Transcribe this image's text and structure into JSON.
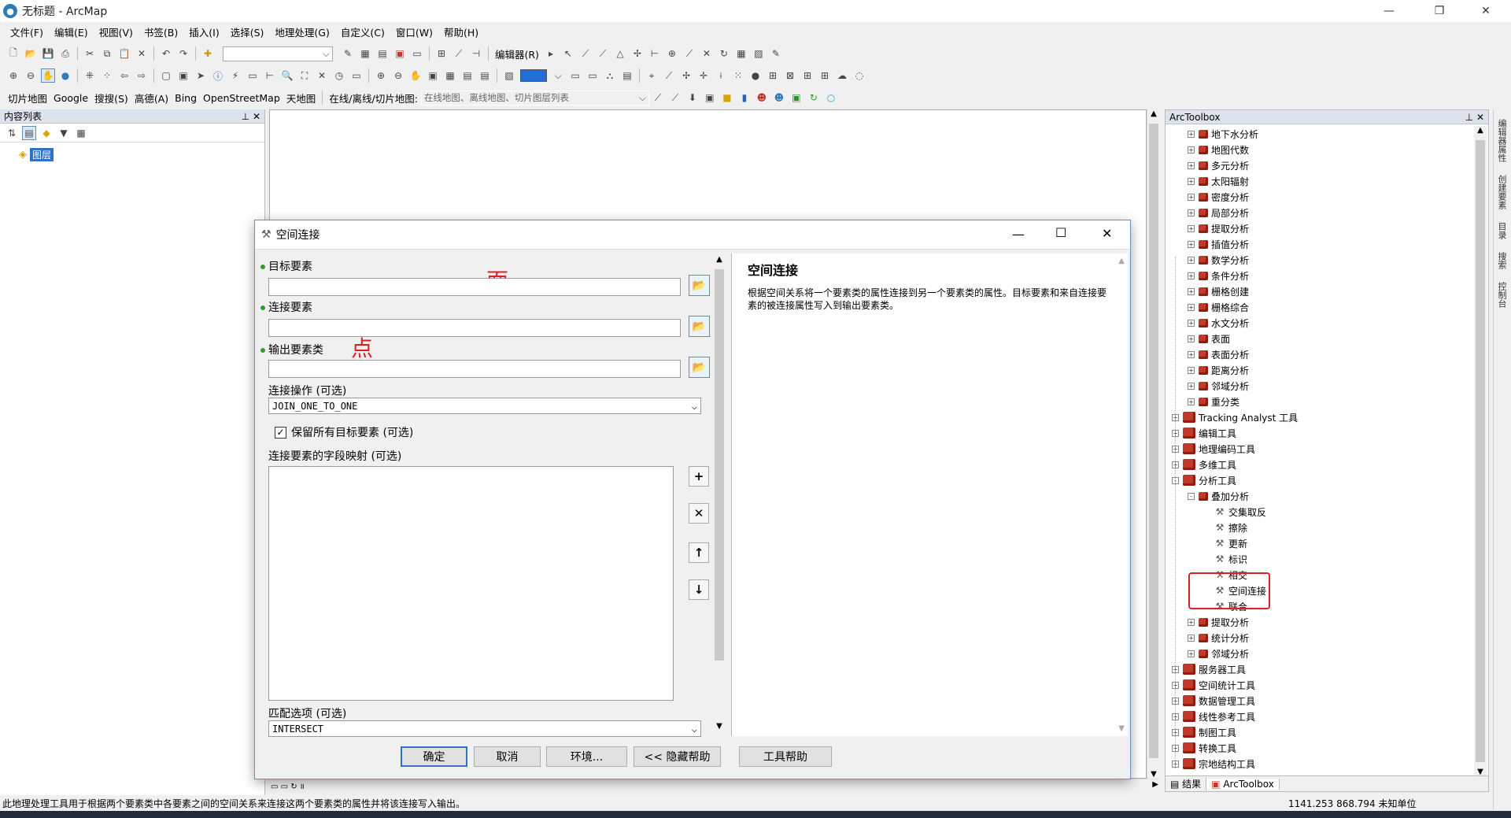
{
  "window": {
    "title": "无标题 - ArcMap"
  },
  "menu": [
    "文件(F)",
    "编辑(E)",
    "视图(V)",
    "书签(B)",
    "插入(I)",
    "选择(S)",
    "地理处理(G)",
    "自定义(C)",
    "窗口(W)",
    "帮助(H)"
  ],
  "toolbar": {
    "editor_label": "编辑器(R)",
    "tile_label": "切片地图",
    "google": "Google",
    "sougou": "搜搜(S)",
    "gaode": "高德(A)",
    "bing": "Bing",
    "osm": "OpenStreetMap",
    "tianditu": "天地图",
    "online_label": "在线/离线/切片地图:",
    "online_combo": "在线地图、离线地图、切片图层列表"
  },
  "toc": {
    "title": "内容列表",
    "layers_label": "图层"
  },
  "dialog": {
    "title": "空间连接",
    "target_label": "目标要素",
    "join_label": "连接要素",
    "output_label": "输出要素类",
    "annotation_face": "面",
    "annotation_point": "点",
    "join_op_label": "连接操作 (可选)",
    "join_op_value": "JOIN_ONE_TO_ONE",
    "keep_all_label": "保留所有目标要素 (可选)",
    "field_map_label": "连接要素的字段映射 (可选)",
    "match_label": "匹配选项 (可选)",
    "match_value": "INTERSECT",
    "help_title": "空间连接",
    "help_text": "根据空间关系将一个要素类的属性连接到另一个要素类的属性。目标要素和来自连接要素的被连接属性写入到输出要素类。",
    "buttons": {
      "ok": "确定",
      "cancel": "取消",
      "env": "环境...",
      "hide_help": "<< 隐藏帮助",
      "tool_help": "工具帮助"
    }
  },
  "arctoolbox": {
    "title": "ArcToolbox",
    "items": [
      {
        "label": "地下水分析",
        "level": 1,
        "type": "toolset",
        "exp": "+"
      },
      {
        "label": "地图代数",
        "level": 1,
        "type": "toolset",
        "exp": "+"
      },
      {
        "label": "多元分析",
        "level": 1,
        "type": "toolset",
        "exp": "+"
      },
      {
        "label": "太阳辐射",
        "level": 1,
        "type": "toolset",
        "exp": "+"
      },
      {
        "label": "密度分析",
        "level": 1,
        "type": "toolset",
        "exp": "+"
      },
      {
        "label": "局部分析",
        "level": 1,
        "type": "toolset",
        "exp": "+"
      },
      {
        "label": "提取分析",
        "level": 1,
        "type": "toolset",
        "exp": "+"
      },
      {
        "label": "插值分析",
        "level": 1,
        "type": "toolset",
        "exp": "+"
      },
      {
        "label": "数学分析",
        "level": 1,
        "type": "toolset",
        "exp": "+"
      },
      {
        "label": "条件分析",
        "level": 1,
        "type": "toolset",
        "exp": "+"
      },
      {
        "label": "栅格创建",
        "level": 1,
        "type": "toolset",
        "exp": "+"
      },
      {
        "label": "栅格综合",
        "level": 1,
        "type": "toolset",
        "exp": "+"
      },
      {
        "label": "水文分析",
        "level": 1,
        "type": "toolset",
        "exp": "+"
      },
      {
        "label": "表面",
        "level": 1,
        "type": "toolset",
        "exp": "+"
      },
      {
        "label": "表面分析",
        "level": 1,
        "type": "toolset",
        "exp": "+"
      },
      {
        "label": "距离分析",
        "level": 1,
        "type": "toolset",
        "exp": "+"
      },
      {
        "label": "邻域分析",
        "level": 1,
        "type": "toolset",
        "exp": "+"
      },
      {
        "label": "重分类",
        "level": 1,
        "type": "toolset",
        "exp": "+"
      },
      {
        "label": "Tracking Analyst 工具",
        "level": 0,
        "type": "toolbox",
        "exp": "+"
      },
      {
        "label": "编辑工具",
        "level": 0,
        "type": "toolbox",
        "exp": "+"
      },
      {
        "label": "地理编码工具",
        "level": 0,
        "type": "toolbox",
        "exp": "+"
      },
      {
        "label": "多维工具",
        "level": 0,
        "type": "toolbox",
        "exp": "+"
      },
      {
        "label": "分析工具",
        "level": 0,
        "type": "toolbox",
        "exp": "-"
      },
      {
        "label": "叠加分析",
        "level": 1,
        "type": "toolset",
        "exp": "-"
      },
      {
        "label": "交集取反",
        "level": 2,
        "type": "tool",
        "exp": ""
      },
      {
        "label": "擦除",
        "level": 2,
        "type": "tool",
        "exp": ""
      },
      {
        "label": "更新",
        "level": 2,
        "type": "tool",
        "exp": ""
      },
      {
        "label": "标识",
        "level": 2,
        "type": "tool",
        "exp": ""
      },
      {
        "label": "相交",
        "level": 2,
        "type": "tool",
        "exp": ""
      },
      {
        "label": "空间连接",
        "level": 2,
        "type": "tool",
        "exp": ""
      },
      {
        "label": "联合",
        "level": 2,
        "type": "tool",
        "exp": ""
      },
      {
        "label": "提取分析",
        "level": 1,
        "type": "toolset",
        "exp": "+"
      },
      {
        "label": "统计分析",
        "level": 1,
        "type": "toolset",
        "exp": "+"
      },
      {
        "label": "邻域分析",
        "level": 1,
        "type": "toolset",
        "exp": "+"
      },
      {
        "label": "服务器工具",
        "level": 0,
        "type": "toolbox",
        "exp": "+"
      },
      {
        "label": "空间统计工具",
        "level": 0,
        "type": "toolbox",
        "exp": "+"
      },
      {
        "label": "数据管理工具",
        "level": 0,
        "type": "toolbox",
        "exp": "+"
      },
      {
        "label": "线性参考工具",
        "level": 0,
        "type": "toolbox",
        "exp": "+"
      },
      {
        "label": "制图工具",
        "level": 0,
        "type": "toolbox",
        "exp": "+"
      },
      {
        "label": "转换工具",
        "level": 0,
        "type": "toolbox",
        "exp": "+"
      },
      {
        "label": "宗地结构工具",
        "level": 0,
        "type": "toolbox",
        "exp": "+"
      }
    ],
    "tabs": {
      "results": "结果",
      "arctoolbox": "ArcToolbox"
    }
  },
  "right_tabs": [
    "编辑器属性",
    "创建要素",
    "目录",
    "搜索",
    "控制台"
  ],
  "status": {
    "message": "此地理处理工具用于根据两个要素类中各要素之间的空间关系来连接这两个要素类的属性并将该连接写入输出。",
    "coords": "1141.253  868.794 未知单位"
  },
  "colors": {
    "highlight_box": "#e02020",
    "annotation": "#e02020",
    "accent": "#3070c8"
  }
}
